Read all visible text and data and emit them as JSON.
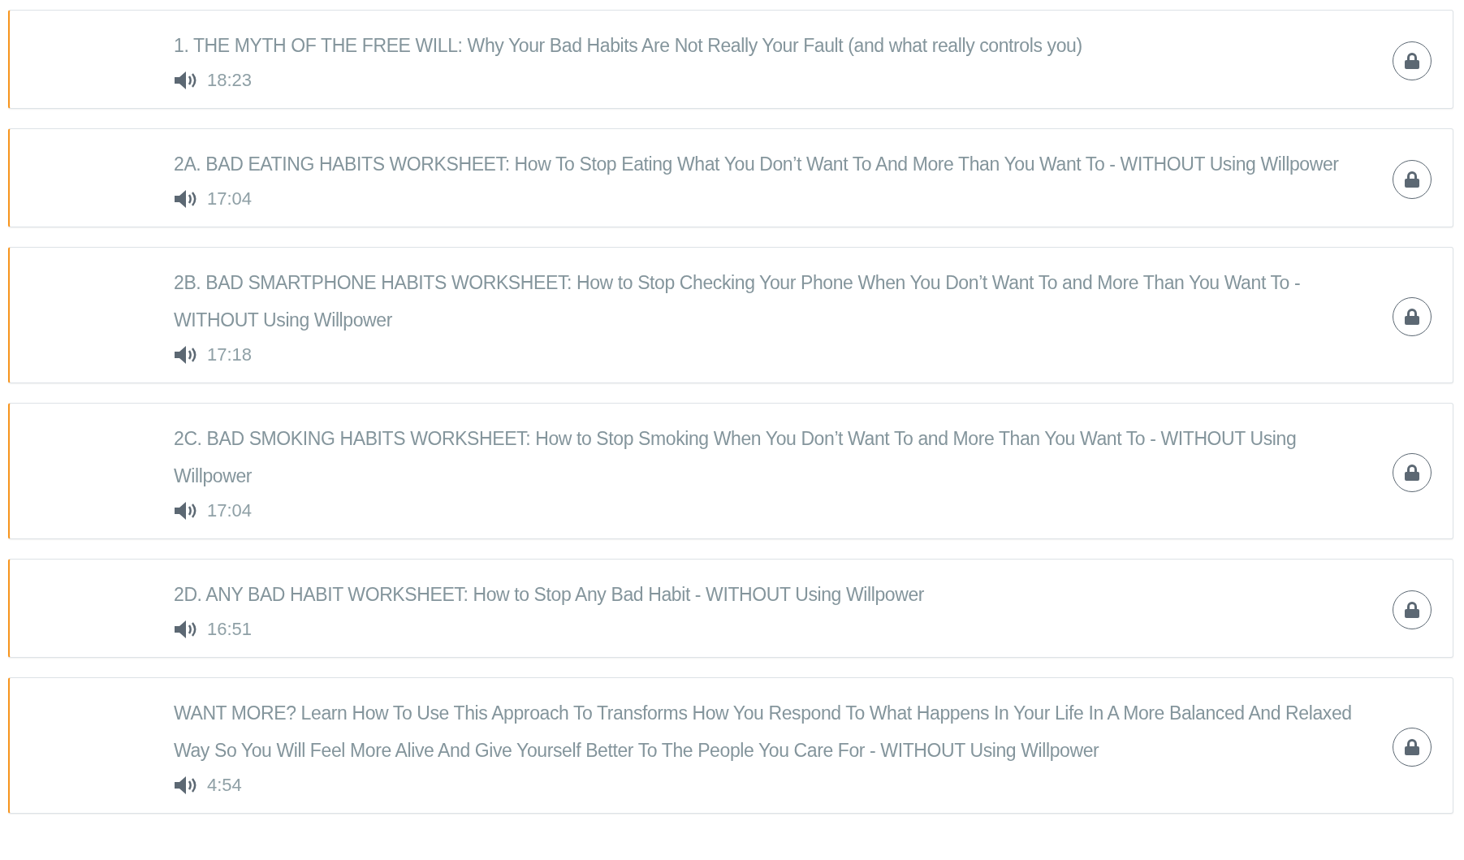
{
  "lessons": [
    {
      "title": "1. THE MYTH OF THE FREE WILL: Why Your Bad Habits Are Not Really Your Fault (and what really controls you)",
      "duration": "18:23",
      "locked": true
    },
    {
      "title": "2A. BAD EATING HABITS WORKSHEET: How To Stop Eating What You Don’t Want To And More Than You Want To - WITHOUT Using Willpower",
      "duration": "17:04",
      "locked": true
    },
    {
      "title": "2B. BAD SMARTPHONE HABITS WORKSHEET: How to Stop Checking Your Phone When You Don’t Want To and More Than You Want To - WITHOUT Using Willpower",
      "duration": "17:18",
      "locked": true
    },
    {
      "title": "2C. BAD SMOKING HABITS WORKSHEET: How to Stop Smoking When You Don’t Want To and More Than You Want To - WITHOUT Using Willpower",
      "duration": "17:04",
      "locked": true
    },
    {
      "title": "2D. ANY BAD HABIT WORKSHEET: How to Stop Any Bad Habit - WITHOUT Using Willpower",
      "duration": "16:51",
      "locked": true
    },
    {
      "title": "WANT MORE? Learn How To Use This Approach To Transforms How You Respond To What Happens In Your Life In A More Balanced And Relaxed Way So You Will Feel More Alive And Give Yourself Better To The People You Care For - WITHOUT Using Willpower",
      "duration": "4:54",
      "locked": true
    }
  ]
}
